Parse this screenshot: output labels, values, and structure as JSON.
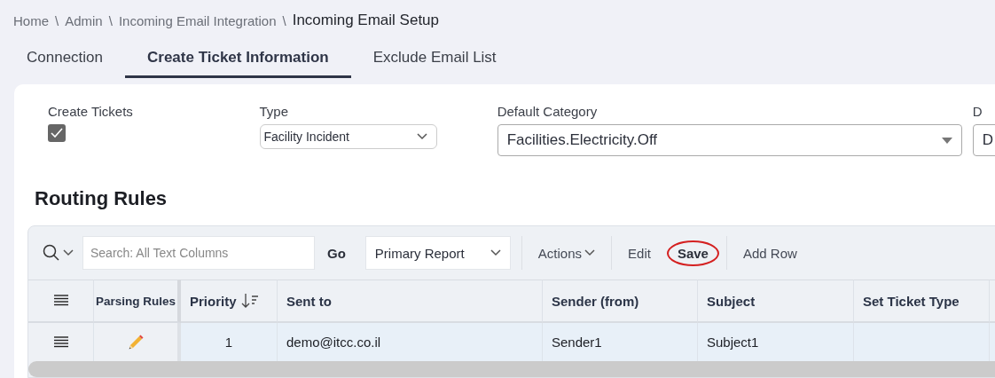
{
  "breadcrumb": [
    {
      "label": "Home",
      "current": false
    },
    {
      "label": "Admin",
      "separator": "\\",
      "current": false
    },
    {
      "label": "Incoming Email Integration",
      "separator": "\\",
      "current": false
    },
    {
      "label": "Incoming Email Setup",
      "separator": "\\",
      "current": true
    }
  ],
  "tabs": [
    {
      "label": "Connection",
      "selected": false
    },
    {
      "label": "Create Ticket Information",
      "selected": true
    },
    {
      "label": "Exclude Email List",
      "selected": false
    }
  ],
  "fields": [
    {
      "kind": "checkbox",
      "label": "Create Tickets",
      "checked": true
    },
    {
      "kind": "select",
      "label": "Type",
      "value": "Facility Incident"
    },
    {
      "kind": "combo",
      "label": "Default Category",
      "value": "Facilities.Electricity.Off"
    },
    {
      "kind": "combo",
      "label": "D",
      "value": "D"
    }
  ],
  "routing_rules": {
    "title": "Routing Rules",
    "search": {
      "placeholder": "Search: All Text Columns"
    },
    "go_button": "Go",
    "report_select": "Primary Report",
    "toolbar": [
      {
        "kind": "menu",
        "label": "Actions",
        "divider_before": true,
        "highlighted": false
      },
      {
        "kind": "button",
        "label": "Edit",
        "divider_before": true,
        "highlighted": false
      },
      {
        "kind": "button",
        "label": "Save",
        "divider_before": false,
        "highlighted": true
      },
      {
        "kind": "button",
        "label": "Add Row",
        "divider_before": true,
        "highlighted": false
      }
    ],
    "table": {
      "columns": [
        {
          "label": "Parsing Rules",
          "sorted": false
        },
        {
          "label": "Priority",
          "sorted": true
        },
        {
          "label": "Sent to",
          "sorted": false
        },
        {
          "label": "Sender (from)",
          "sorted": false
        },
        {
          "label": "Subject",
          "sorted": false
        },
        {
          "label": "Set Ticket Type",
          "sorted": false
        }
      ],
      "rows": [
        {
          "cells": [
            {
              "kind": "edit"
            },
            {
              "kind": "number",
              "text": "1"
            },
            {
              "kind": "text",
              "text": "demo@itcc.co.il"
            },
            {
              "kind": "text",
              "text": "Sender1"
            },
            {
              "kind": "text",
              "text": "Subject1"
            }
          ]
        }
      ]
    }
  }
}
